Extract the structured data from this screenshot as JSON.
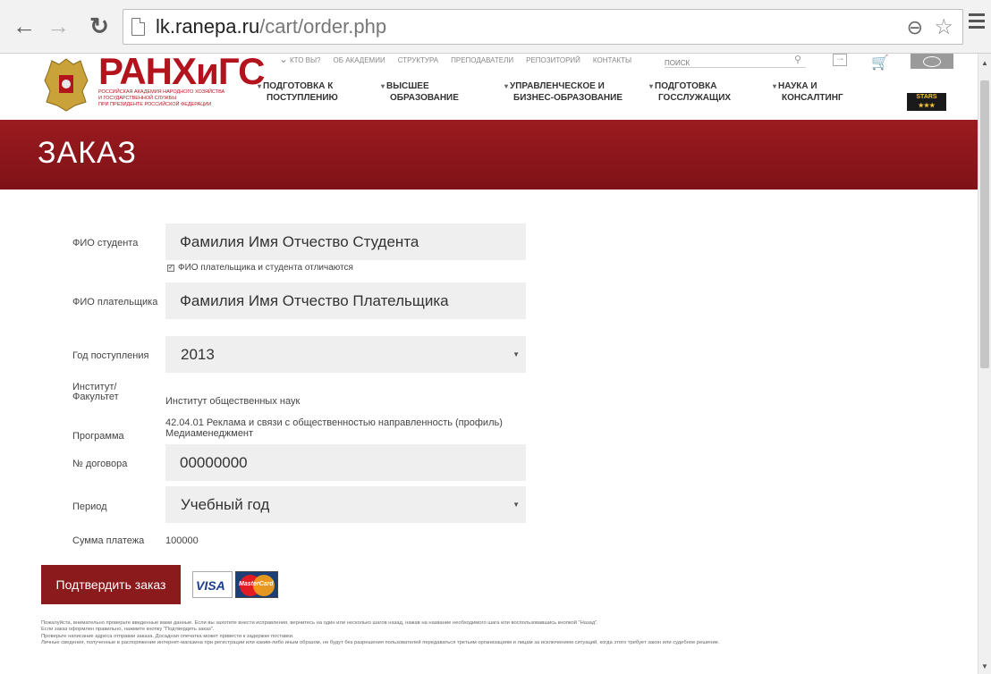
{
  "browser": {
    "url_host": "lk.ranepa.ru",
    "url_path": "/cart/order.php"
  },
  "site": {
    "logo_title": "РАНХиГС",
    "logo_subtitle_1": "Российская академия народного хозяйства",
    "logo_subtitle_2": "и государственной службы",
    "logo_subtitle_3": "при Президенте Российской Федерации",
    "top_nav": [
      "Кто вы?",
      "Об академии",
      "Структура",
      "Преподаватели",
      "Репозиторий",
      "Контакты"
    ],
    "search_placeholder": "Поиск",
    "main_nav": [
      {
        "line1": "Подготовка к",
        "line2": "поступлению"
      },
      {
        "line1": "Высшее",
        "line2": "образование"
      },
      {
        "line1": "Управленческое и",
        "line2": "бизнес-образование"
      },
      {
        "line1": "Подготовка",
        "line2": "госслужащих"
      },
      {
        "line1": "Наука и",
        "line2": "консалтинг"
      }
    ],
    "stars_badge": "STARS",
    "stars_sub": "★★★"
  },
  "page": {
    "title": "ЗАКАЗ"
  },
  "form": {
    "student_label": "ФИО студента",
    "student_value": "Фамилия Имя Отчество Студента",
    "payer_differs_label": "ФИО плательщика и студента отличаются",
    "payer_label": "ФИО плательщика",
    "payer_value": "Фамилия Имя Отчество Плательщика",
    "year_label": "Год поступления",
    "year_value": "2013",
    "institute_label_1": "Институт/",
    "institute_label_2": "Факультет",
    "institute_value": "Институт общественных наук",
    "program_label": "Программа",
    "program_value_1": "42.04.01 Реклама и связи с общественностью направленность (профиль)",
    "program_value_2": "Медиаменеджмент",
    "contract_label": "№ договора",
    "contract_value": "00000000",
    "period_label": "Период",
    "period_value": "Учебный год",
    "amount_label": "Сумма платежа",
    "amount_value": "100000",
    "confirm_label": "Подтвердить заказ",
    "visa_label": "VISA",
    "mastercard_label": "MasterCard"
  },
  "notes": [
    "Пожалуйста, внимательно проверьте введенные вами данные. Если вы захотите внести исправления, вернитесь на один или несколько шагов назад, нажав на название необходимого шага или воспользовавшись кнопкой \"Назад\".",
    "Если заказ оформлен правильно, нажмите кнопку \"Подтвердить заказ\".",
    "Проверьте написание адреса отправки заказа. Досадная опечатка может привести к задержке поставки.",
    "Личные сведения, полученные в распоряжение интернет-магазина при регистрации или каким-либо иным образом, не будут без разрешения пользователей передаваться третьим организациям и лицам за исключением ситуаций, когда этого требует закон или судебное решение."
  ]
}
